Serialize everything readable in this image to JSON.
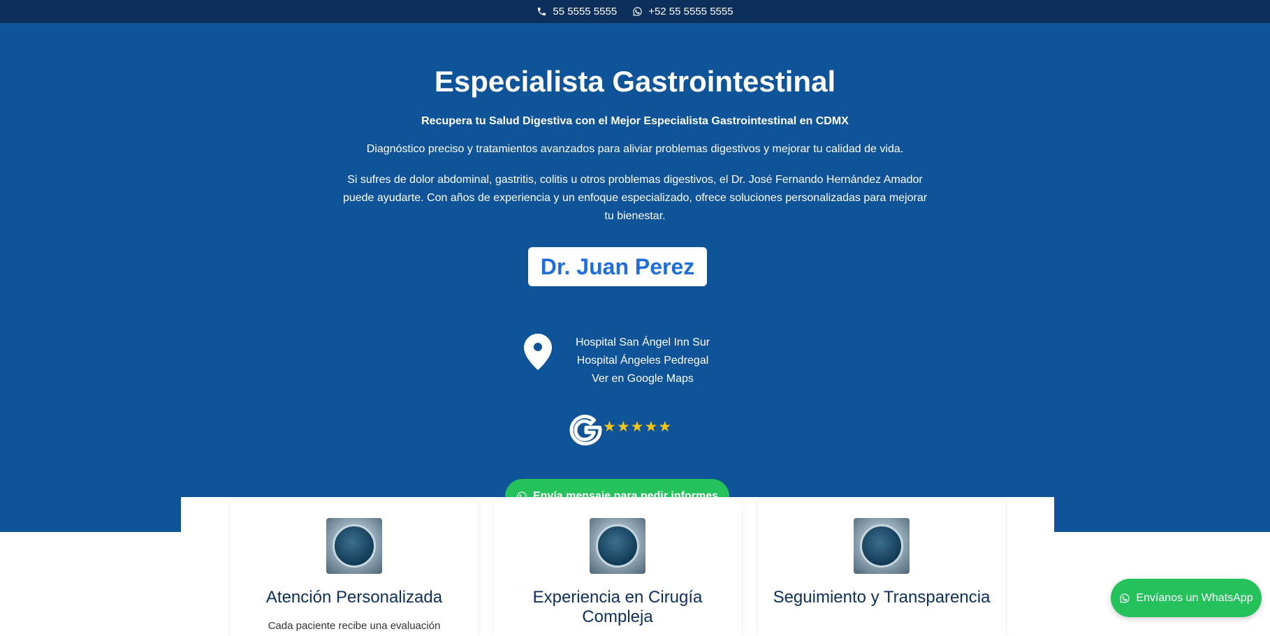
{
  "topbar": {
    "phone": "55 5555 5555",
    "whatsapp": "+52 55 5555 5555"
  },
  "hero": {
    "title": "Especialista Gastrointestinal",
    "subtitle": "Recupera tu Salud Digestiva con el Mejor Especialista Gastrointestinal en CDMX",
    "lead": "Diagnóstico preciso y tratamientos avanzados para aliviar problemas digestivos y mejorar tu calidad de vida.",
    "description": "Si sufres de dolor abdominal, gastritis, colitis u otros problemas digestivos, el Dr. José Fernando Hernández Amador puede ayudarte. Con años de experiencia y un enfoque especializado, ofrece soluciones personalizadas para mejorar tu bienestar.",
    "doctor_name": "Dr. Juan Perez",
    "locations": [
      "Hospital San Ángel Inn Sur",
      "Hospital Ángeles Pedregal"
    ],
    "maps_link": "Ver en Google Maps",
    "rating_stars": 5,
    "cta_label": "Envía mensaje para pedir informes"
  },
  "cards": [
    {
      "title": "Atención Personalizada",
      "text": "Cada paciente recibe una evaluación"
    },
    {
      "title": "Experiencia en Cirugía Compleja",
      "text": ""
    },
    {
      "title": "Seguimiento y Transparencia",
      "text": ""
    }
  ],
  "floating": {
    "whatsapp_label": "Envíanos un WhatsApp"
  },
  "colors": {
    "topbar": "#0c2f5c",
    "hero": "#0f5499",
    "accent_blue": "#1e6fd9",
    "whatsapp_green": "#25c25c",
    "star": "#f5c518"
  }
}
